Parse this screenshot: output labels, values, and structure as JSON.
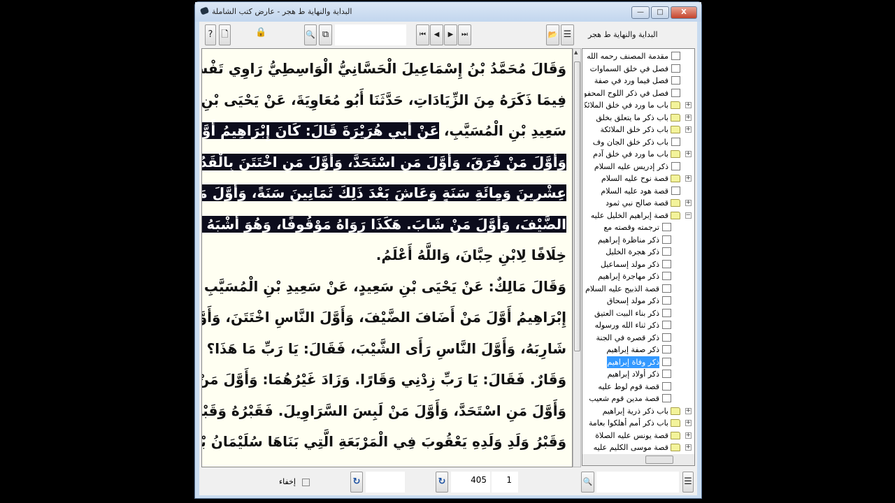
{
  "window": {
    "title": "البداية والنهاية ط هجر - عارض كتب الشاملة",
    "minimize": "—",
    "maximize": "□",
    "close": "X"
  },
  "toolbar": {
    "help": "?",
    "new_doc": "🗋",
    "lock": "🔒",
    "search": "🔍",
    "search_doc": "⧉",
    "search_value": "",
    "first": "⏮",
    "prev": "◀",
    "next": "▶",
    "last": "⏭",
    "open": "📂",
    "tree_toggle": "☰",
    "book_title": "البداية والنهاية ط هجر"
  },
  "text_lines": [
    [
      {
        "t": "وَقَالَ مُحَمَّدُ بْنُ إِسْمَاعِيلَ الْحَسَّانِيُّ الْوَاسِطِيُّ رَاوِي تَفْسِيرِ وَكِيعٍ عَنْهُ",
        "s": false
      }
    ],
    [
      {
        "t": "فِيمَا ذَكَرَهُ مِنَ الزِّيَادَاتِ، حَدَّثَنَا أَبُو مُعَاوِيَةَ، عَنْ يَحْيَى بْنِ سَعِيدٍ، عَنْ",
        "s": false
      }
    ],
    [
      {
        "t": "سَعِيدِ بْنِ الْمُسَيَّبِ، ",
        "s": false
      },
      {
        "t": "عَنْ أَبِي هُرَيْرَةَ قَالَ: كَانَ إِبْرَاهِيمُ أَوَّلَ مَنْ تَسَرْوَلَ،",
        "s": true
      }
    ],
    [
      {
        "t": "وَأَوَّلَ مَنْ فَرَقَ، وَأَوَّلَ مَنِ اسْتَحَدَّ، وَأَوَّلَ مَنِ اخْتَتَنَ بِالْقَدُومِ وَهُوَ ابْنُ",
        "s": true
      }
    ],
    [
      {
        "t": "عِشْرِينَ وَمِائَةِ سَنَةٍ وَعَاشَ بَعْدَ ذَلِكَ ثَمَانِينَ سَنَةً، وَأَوَّلَ مَنْ قَرَى",
        "s": true
      }
    ],
    [
      {
        "t": "الضَّيْفَ، وَأَوَّلَ مَنْ شَابَ. هَكَذَا رَوَاهُ مَوْقُوفًا، وَهُوَ أَشْبَهُ بِالْمَرْفُوعِ",
        "s": true
      }
    ],
    [
      {
        "t": "خِلَافًا لِابْنِ حِبَّانَ، وَاللَّهُ أَعْلَمُ.",
        "s": false
      }
    ],
    [
      {
        "t": "وَقَالَ مَالِكٌ: عَنْ يَحْيَى بْنِ سَعِيدٍ، عَنْ سَعِيدِ بْنِ الْمُسَيَّبِ قَالَ: كَانَ",
        "s": false
      }
    ],
    [
      {
        "t": "إِبْرَاهِيمُ أَوَّلَ مَنْ أَضَافَ الضَّيْفَ، وَأَوَّلَ النَّاسِ اخْتَتَنَ، وَأَوَّلَ النَّاسِ قَصَّ",
        "s": false
      }
    ],
    [
      {
        "t": "شَارِبَهُ، وَأَوَّلَ النَّاسِ رَأَى الشَّيْبَ، فَقَالَ: يَا رَبِّ مَا هَذَا؟ فَقَالَ اللَّهُ:",
        "s": false
      }
    ],
    [
      {
        "t": "وَقَارٌ. فَقَالَ: يَا رَبِّ زِدْنِي وَقَارًا. وَزَادَ غَيْرُهُمَا: وَأَوَّلَ مَنْ قَصَّ شَارِبَهُ،",
        "s": false
      }
    ],
    [
      {
        "t": "وَأَوَّلَ مَنِ اسْتَحَدَّ، وَأَوَّلَ مَنْ لَبِسَ السَّرَاوِيلَ. فَقَبْرُهُ وَقَبْرُ وَلَدِهِ إِسْحَاقَ",
        "s": false
      }
    ],
    [
      {
        "t": "وَقَبْرُ وَلَدِ وَلَدِهِ يَعْقُوبَ فِي الْمَرْبَعَةِ الَّتِي بَنَاهَا سُلَيْمَانُ بْنُ دَاوُدَ عَلَيْهِ",
        "s": false
      }
    ]
  ],
  "tree": [
    {
      "label": "مقدمة المصنف رحمه الله",
      "level": 0,
      "type": "leaf"
    },
    {
      "label": "فصل في خلق السماوات",
      "level": 0,
      "type": "leaf"
    },
    {
      "label": "فصل فيما ورد في صفة",
      "level": 0,
      "type": "leaf"
    },
    {
      "label": "فصل في ذكر اللوح المحفوظ",
      "level": 0,
      "type": "leaf"
    },
    {
      "label": "باب ما ورد في خلق الملائكة",
      "level": 0,
      "type": "folder",
      "exp": "+"
    },
    {
      "label": "باب ذكر ما يتعلق بخلق",
      "level": 0,
      "type": "folder",
      "exp": "+"
    },
    {
      "label": "باب ذكر خلق الملائكة",
      "level": 0,
      "type": "folder",
      "exp": "+"
    },
    {
      "label": "باب ذكر خلق الجان وف",
      "level": 0,
      "type": "leaf"
    },
    {
      "label": "باب ما ورد في خلق آدم",
      "level": 0,
      "type": "folder",
      "exp": "+"
    },
    {
      "label": "ذكر إدريس عليه السلام",
      "level": 0,
      "type": "leaf"
    },
    {
      "label": "قصة نوح عليه السلام",
      "level": 0,
      "type": "folder",
      "exp": "+"
    },
    {
      "label": "قصة هود عليه السلام",
      "level": 0,
      "type": "leaf"
    },
    {
      "label": "قصة صالح نبي ثمود",
      "level": 0,
      "type": "folder",
      "exp": "+"
    },
    {
      "label": "قصة إبراهيم الخليل عليه",
      "level": 0,
      "type": "folder",
      "exp": "−"
    },
    {
      "label": "ترجمته وقصته مع",
      "level": 1,
      "type": "leaf"
    },
    {
      "label": "ذكر مناظرة إبراهيم",
      "level": 1,
      "type": "leaf"
    },
    {
      "label": "ذكر هجرة الخليل",
      "level": 1,
      "type": "leaf"
    },
    {
      "label": "ذكر مولد إسماعيل",
      "level": 1,
      "type": "leaf"
    },
    {
      "label": "ذكر مهاجرة إبراهيم",
      "level": 1,
      "type": "leaf"
    },
    {
      "label": "قصة الذبيح عليه السلام",
      "level": 1,
      "type": "leaf"
    },
    {
      "label": "ذكر مولد إسحاق",
      "level": 1,
      "type": "leaf"
    },
    {
      "label": "ذكر بناء البيت العتيق",
      "level": 1,
      "type": "leaf"
    },
    {
      "label": "ذكر ثناء الله ورسوله",
      "level": 1,
      "type": "leaf"
    },
    {
      "label": "ذكر قصره في الجنة",
      "level": 1,
      "type": "leaf"
    },
    {
      "label": "ذكر صفة إبراهيم",
      "level": 1,
      "type": "leaf"
    },
    {
      "label": "ذكر وفاة إبراهيم",
      "level": 1,
      "type": "leaf",
      "selected": true
    },
    {
      "label": "ذكر أولاد إبراهيم",
      "level": 1,
      "type": "leaf"
    },
    {
      "label": "قصة قوم لوط عليه",
      "level": 1,
      "type": "leaf"
    },
    {
      "label": "قصة مدين قوم شعيب",
      "level": 1,
      "type": "leaf"
    },
    {
      "label": "باب ذكر ذرية إبراهيم",
      "level": 0,
      "type": "folder",
      "exp": "+"
    },
    {
      "label": "باب ذكر أمم أهلكوا بعامة",
      "level": 0,
      "type": "folder",
      "exp": "+"
    },
    {
      "label": "قصة يونس عليه الصلاة",
      "level": 0,
      "type": "folder",
      "exp": "+"
    },
    {
      "label": "قصة موسى الكليم عليه",
      "level": 0,
      "type": "folder",
      "exp": "+"
    }
  ],
  "bottom": {
    "hide_label": "إخفاء",
    "refresh": "↻",
    "field_a": "",
    "page": "405",
    "part": "1",
    "search": "🔍",
    "search_value": "",
    "list": "☰"
  }
}
